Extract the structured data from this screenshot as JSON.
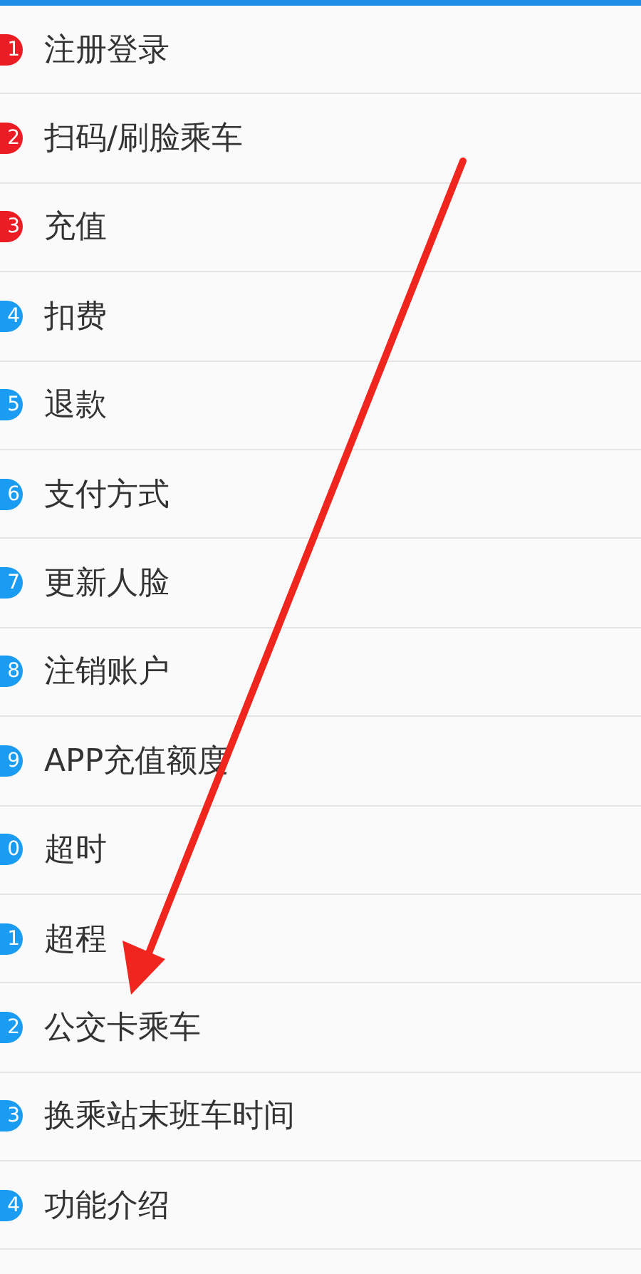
{
  "items": [
    {
      "badge": "1",
      "label": "注册登录",
      "color": "#ec1c24"
    },
    {
      "badge": "2",
      "label": "扫码/刷脸乘车",
      "color": "#ec1c24"
    },
    {
      "badge": "3",
      "label": "充值",
      "color": "#ec1c24"
    },
    {
      "badge": "4",
      "label": "扣费",
      "color": "#1a9cf2"
    },
    {
      "badge": "5",
      "label": "退款",
      "color": "#1a9cf2"
    },
    {
      "badge": "6",
      "label": "支付方式",
      "color": "#1a9cf2"
    },
    {
      "badge": "7",
      "label": "更新人脸",
      "color": "#1a9cf2"
    },
    {
      "badge": "8",
      "label": "注销账户",
      "color": "#1a9cf2"
    },
    {
      "badge": "9",
      "label": "APP充值额度",
      "color": "#1a9cf2"
    },
    {
      "badge": "0",
      "label": "超时",
      "color": "#1a9cf2"
    },
    {
      "badge": "1",
      "label": "超程",
      "color": "#1a9cf2"
    },
    {
      "badge": "2",
      "label": "公交卡乘车",
      "color": "#1a9cf2"
    },
    {
      "badge": "3",
      "label": "换乘站末班车时间",
      "color": "#1a9cf2"
    },
    {
      "badge": "4",
      "label": "功能介绍",
      "color": "#1a9cf2"
    }
  ]
}
